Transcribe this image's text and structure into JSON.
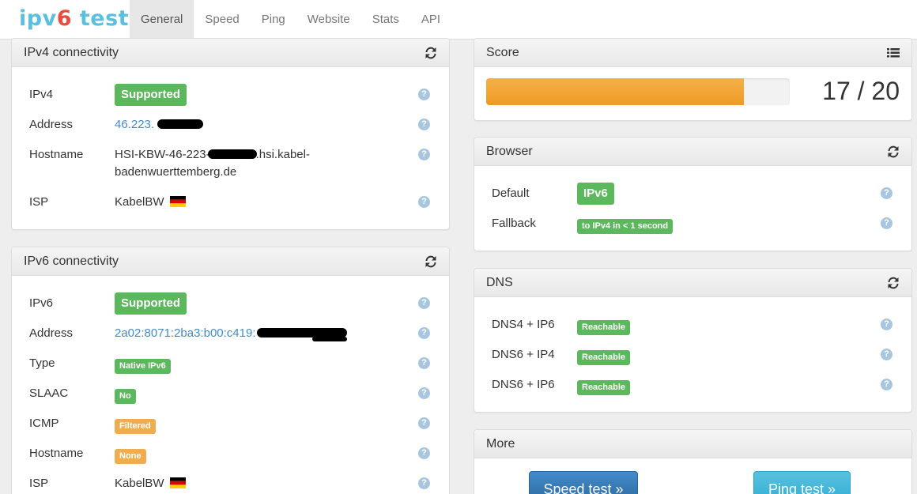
{
  "brand": {
    "part1": "ipv",
    "part2": "6",
    "part3": " test"
  },
  "nav": [
    {
      "label": "General",
      "active": true
    },
    {
      "label": "Speed"
    },
    {
      "label": "Ping"
    },
    {
      "label": "Website"
    },
    {
      "label": "Stats"
    },
    {
      "label": "API"
    }
  ],
  "ipv4": {
    "title": "IPv4 connectivity",
    "rows": {
      "ipv4": {
        "label": "IPv4",
        "value": "Supported"
      },
      "address": {
        "label": "Address",
        "value": "46.223."
      },
      "hostname": {
        "label": "Hostname",
        "line1_a": "HSI-KBW-46-223-",
        "line1_b": ".hsi.kabel-",
        "line2": "badenwuerttemberg.de"
      },
      "isp": {
        "label": "ISP",
        "value": "KabelBW"
      }
    }
  },
  "ipv6": {
    "title": "IPv6 connectivity",
    "rows": {
      "ipv6": {
        "label": "IPv6",
        "value": "Supported"
      },
      "address": {
        "label": "Address",
        "value": "2a02:8071:2ba3:b00:c419:"
      },
      "type": {
        "label": "Type",
        "value": "Native IPv6"
      },
      "slaac": {
        "label": "SLAAC",
        "value": "No"
      },
      "icmp": {
        "label": "ICMP",
        "value": "Filtered"
      },
      "hostname": {
        "label": "Hostname",
        "value": "None"
      },
      "isp": {
        "label": "ISP",
        "value": "KabelBW"
      }
    }
  },
  "score": {
    "title": "Score",
    "text": "17 / 20",
    "fraction": 0.85
  },
  "browser": {
    "title": "Browser",
    "default": {
      "label": "Default",
      "value": "IPv6"
    },
    "fallback": {
      "label": "Fallback",
      "value": "to IPv4 in < 1 second"
    }
  },
  "dns": {
    "title": "DNS",
    "rows": [
      {
        "label": "DNS4 + IP6",
        "value": "Reachable"
      },
      {
        "label": "DNS6 + IP4",
        "value": "Reachable"
      },
      {
        "label": "DNS6 + IP6",
        "value": "Reachable"
      }
    ]
  },
  "more": {
    "title": "More",
    "speed_btn": "Speed test »",
    "ping_btn": "Ping test »"
  },
  "help_glyph": "?",
  "colors": {
    "green": "#5cb85c",
    "orange": "#f0ad4e",
    "link": "#428bca",
    "progress": "#f0a030"
  }
}
